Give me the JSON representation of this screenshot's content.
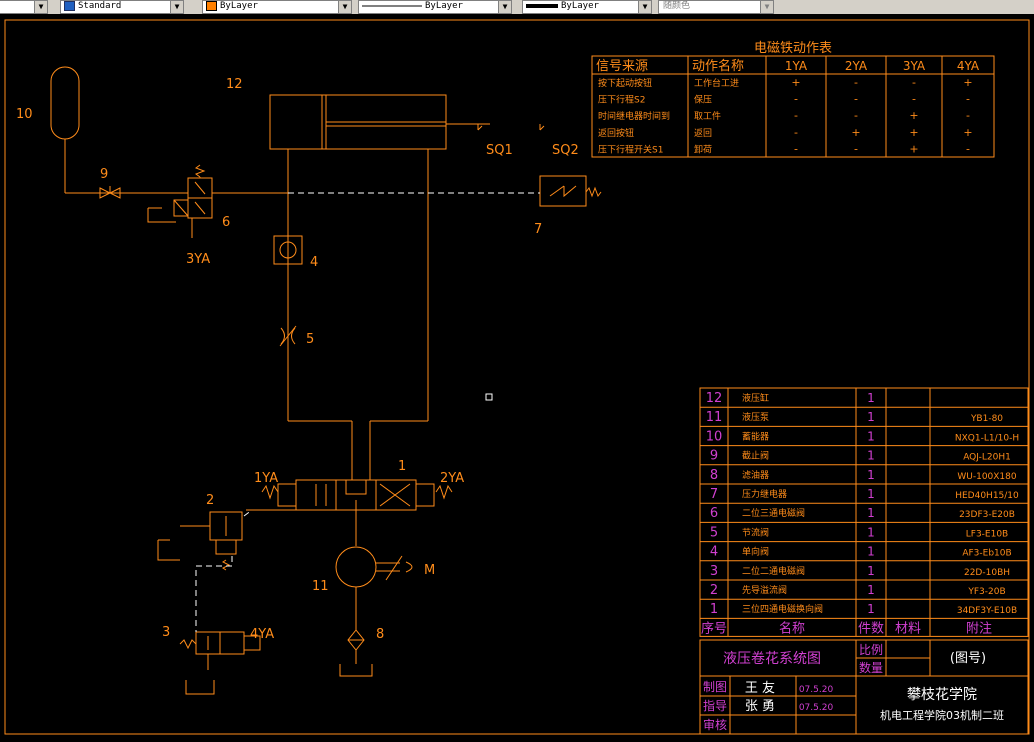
{
  "toolbar": {
    "text_style": "Standard",
    "color": "ByLayer",
    "linetype": "ByLayer",
    "lineweight": "ByLayer",
    "plot_style": "随颜色",
    "color_swatch": "#ff8000"
  },
  "colors": {
    "drawing": "#ff8c1a",
    "title_text": "#d040d0",
    "white_text": "#ffffff",
    "dashed": "#ffffff"
  },
  "labels": {
    "n10": "10",
    "n12": "12",
    "n9": "9",
    "n6": "6",
    "ya3": "3YA",
    "n4": "4",
    "n5": "5",
    "n7": "7",
    "sq1": "SQ1",
    "sq2": "SQ2",
    "ya1": "1YA",
    "n1": "1",
    "ya2": "2YA",
    "n2": "2",
    "n11": "11",
    "m": "M",
    "n8": "8",
    "n3": "3",
    "ya4": "4YA"
  },
  "action_table": {
    "title": "电磁铁动作表",
    "headers": [
      "信号来源",
      "动作名称",
      "1YA",
      "2YA",
      "3YA",
      "4YA"
    ],
    "rows": [
      [
        "按下起动按钮",
        "工作台工进",
        "+",
        "-",
        "-",
        "+"
      ],
      [
        "压下行程S2",
        "保压",
        "-",
        "-",
        "-",
        "-"
      ],
      [
        "时间继电器时间到",
        "取工件",
        "-",
        "-",
        "+",
        "-"
      ],
      [
        "返回按钮",
        "返回",
        "-",
        "+",
        "+",
        "+"
      ],
      [
        "压下行程开关S1",
        "卸荷",
        "-",
        "-",
        "+",
        "-"
      ]
    ]
  },
  "parts_list": {
    "rows": [
      {
        "no": "12",
        "name": "液压缸",
        "qty": "1",
        "spec": ""
      },
      {
        "no": "11",
        "name": "液压泵",
        "qty": "1",
        "spec": "YB1-80"
      },
      {
        "no": "10",
        "name": "蓄能器",
        "qty": "1",
        "spec": "NXQ1-L1/10-H"
      },
      {
        "no": "9",
        "name": "截止阀",
        "qty": "1",
        "spec": "AQJ-L20H1"
      },
      {
        "no": "8",
        "name": "滤油器",
        "qty": "1",
        "spec": "WU-100X180"
      },
      {
        "no": "7",
        "name": "压力继电器",
        "qty": "1",
        "spec": "HED40H15/10"
      },
      {
        "no": "6",
        "name": "二位三通电磁阀",
        "qty": "1",
        "spec": "23DF3-E20B"
      },
      {
        "no": "5",
        "name": "节流阀",
        "qty": "1",
        "spec": "LF3-E10B"
      },
      {
        "no": "4",
        "name": "单向阀",
        "qty": "1",
        "spec": "AF3-Eb10B"
      },
      {
        "no": "3",
        "name": "二位二通电磁阀",
        "qty": "1",
        "spec": "22D-10BH"
      },
      {
        "no": "2",
        "name": "先导溢流阀",
        "qty": "1",
        "spec": "YF3-20B"
      },
      {
        "no": "1",
        "name": "三位四通电磁换向阀",
        "qty": "1",
        "spec": "34DF3Y-E10B"
      }
    ],
    "header_no": "序号",
    "header_name": "名称",
    "header_qty": "件数",
    "header_material": "材料",
    "header_note": "附注"
  },
  "title_block": {
    "drawing_title": "液压卷花系统图",
    "scale_label": "比例",
    "qty_label": "数量",
    "drawing_no": "(图号)",
    "draw_label": "制图",
    "draw_name": "王 友",
    "draw_date": "07.5.20",
    "guide_label": "指导",
    "guide_name": "张 勇",
    "guide_date": "07.5.20",
    "review_label": "审核",
    "school": "攀枝花学院",
    "class": "机电工程学院03机制二班"
  }
}
